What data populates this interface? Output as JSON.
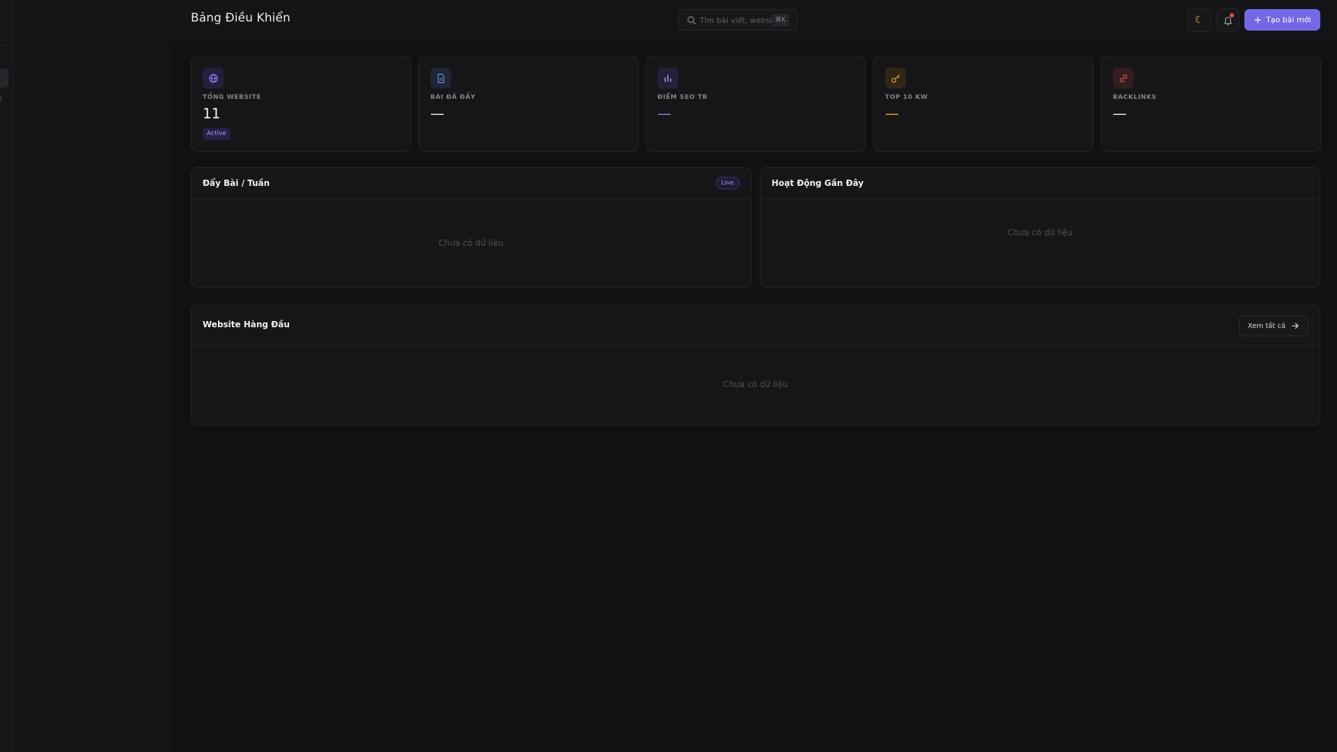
{
  "header": {
    "title": "Bảng Điều Khiển",
    "search_placeholder": "Tìm bài viết, website...",
    "search_shortcut": "⌘K",
    "theme_icon": "moon-icon",
    "notification_icon": "bell-icon",
    "create_label": "Tạo bài mới"
  },
  "stats": [
    {
      "label": "TỔNG WEBSITE",
      "value": "11",
      "badge": "Active",
      "icon": "globe-icon",
      "accent": "#8b7ff0"
    },
    {
      "label": "BÀI ĐÃ ĐẨY",
      "value": "—",
      "icon": "document-icon",
      "accent": "#6b8fd9"
    },
    {
      "label": "ĐIỂM SEO TB",
      "value": "—",
      "icon": "bar-chart-icon",
      "accent": "#8b7ff0"
    },
    {
      "label": "TOP 10 KW",
      "value": "—",
      "icon": "key-icon",
      "accent": "#e0a030"
    },
    {
      "label": "BACKLINKS",
      "value": "—",
      "icon": "link-icon",
      "accent": "#e05a5a"
    }
  ],
  "weekly_panel": {
    "title": "Đẩy Bài / Tuần",
    "badge": "Live",
    "empty_text": "Chưa có dữ liệu"
  },
  "activity_panel": {
    "title": "Hoạt Động Gần Đây",
    "empty_text": "Chưa có dữ liệu"
  },
  "top_websites_panel": {
    "title": "Website Hàng Đầu",
    "view_all_label": "Xem tất cả",
    "empty_text": "Chưa có dữ liệu"
  }
}
